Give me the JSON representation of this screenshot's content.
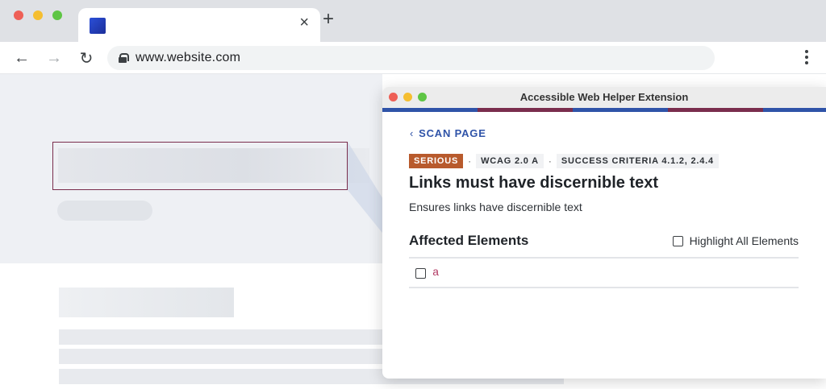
{
  "browser": {
    "url": "www.website.com",
    "tab_close": "×",
    "new_tab": "+",
    "nav_back": "←",
    "nav_forward": "→",
    "nav_reload": "↻"
  },
  "extension": {
    "window_title": "Accessible Web Helper Extension",
    "back_link": "SCAN PAGE",
    "back_chevron": "‹",
    "severity": "SERIOUS",
    "wcag": "WCAG 2.0 A",
    "criteria": "SUCCESS CRITERIA 4.1.2, 2.4.4",
    "separator": "·",
    "issue_title": "Links must have discernible text",
    "issue_description": "Ensures links have discernible text",
    "affected_heading": "Affected Elements",
    "highlight_all_label": "Highlight All Elements",
    "elements": [
      {
        "name": "a"
      }
    ]
  },
  "colors": {
    "accent_blue": "#2f53a8",
    "accent_plum": "#7a2d4d",
    "severity_orange": "#b85a2c",
    "element_pink": "#b23a63"
  }
}
